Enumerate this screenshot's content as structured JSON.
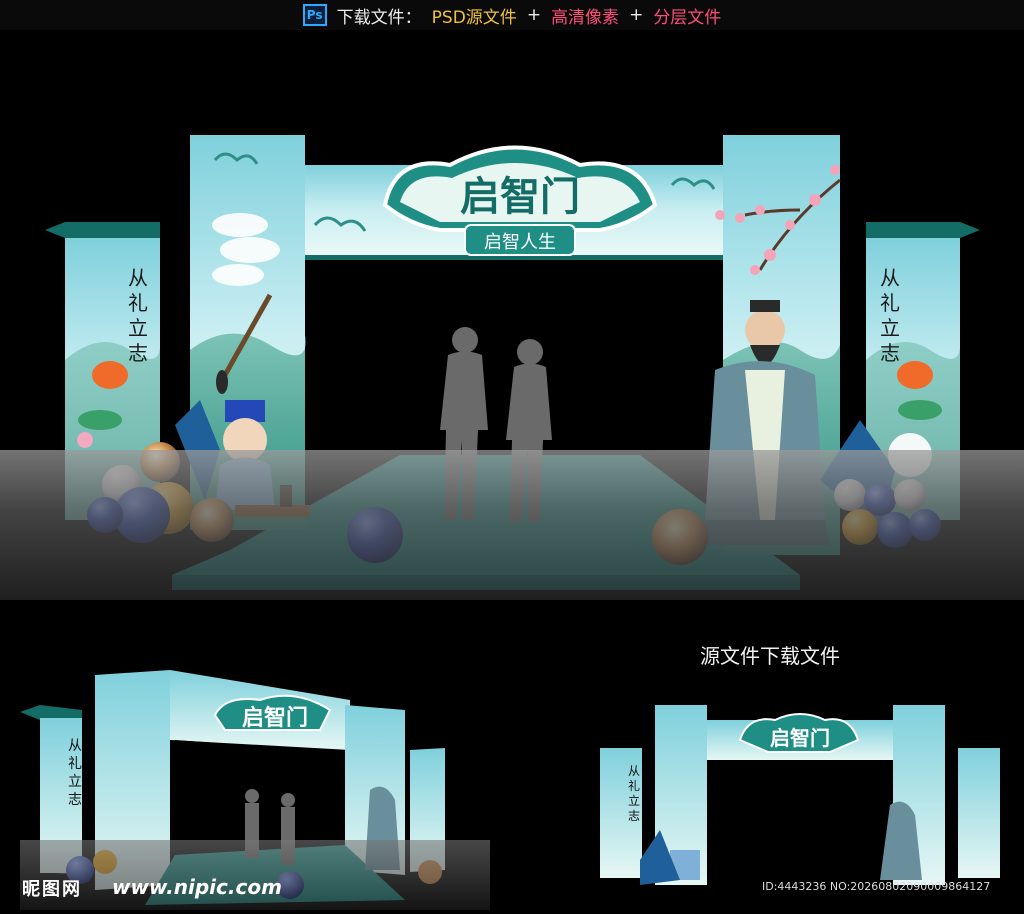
{
  "topbar": {
    "ps_icon": "Ps",
    "prefix": "下载文件：",
    "item1": "PSD源文件",
    "plus1": "+",
    "item2": "高清像素",
    "plus2": "+",
    "item3": "分层文件"
  },
  "arch": {
    "title": "启智门",
    "subtitle": "启智人生",
    "side_text": [
      "从",
      "礼",
      "立",
      "志"
    ]
  },
  "caption": "源文件下载文件",
  "watermark": {
    "site_name": "昵图网",
    "url": "www.nipic.com",
    "id_line": "ID:4443236 NO:20260802090009864127"
  },
  "colors": {
    "teal": "#1f8f86",
    "teal_dark": "#136d66",
    "sky": "#a8e0e8",
    "cloud": "#ffffff",
    "ball_blue": "#2548b8",
    "ball_gold": "#e6a21c"
  }
}
